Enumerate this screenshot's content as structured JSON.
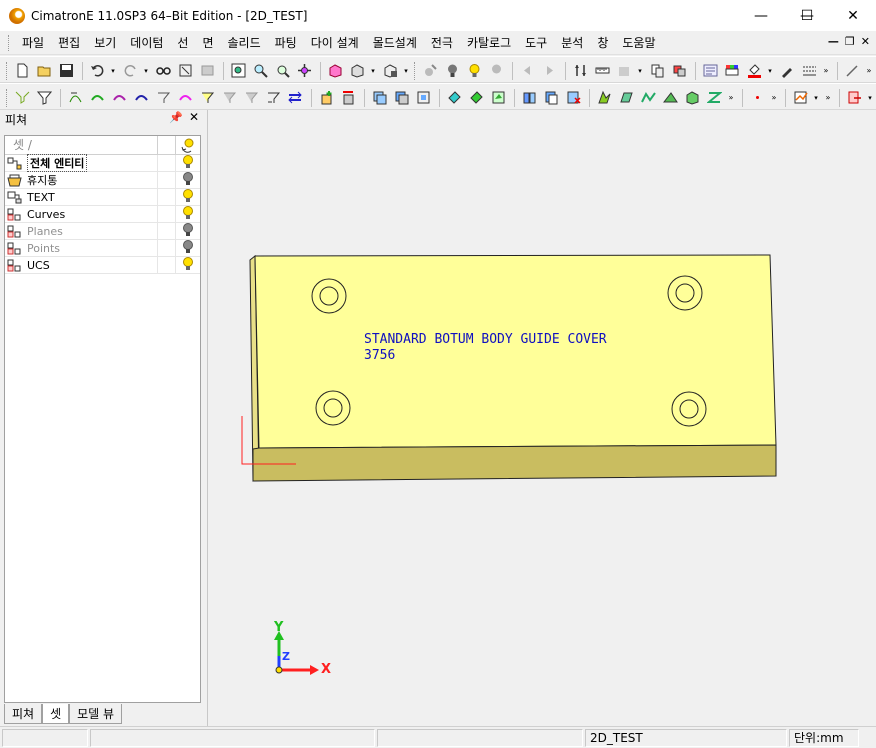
{
  "window": {
    "title": "CimatronE 11.0SP3 64–Bit Edition - [2D_TEST]",
    "minimize_glyph": "—",
    "maximize_glyph": "☐",
    "close_glyph": "✕"
  },
  "menu": {
    "items": [
      "파일",
      "편집",
      "보기",
      "데이텀",
      "선",
      "면",
      "솔리드",
      "파팅",
      "다이 설계",
      "몰드설계",
      "전극",
      "카탈로그",
      "도구",
      "분석",
      "창",
      "도움말"
    ],
    "mdi_controls": [
      "—",
      "❐",
      "✕"
    ]
  },
  "left_panel": {
    "title": "피쳐",
    "pin_glyph": "⬆",
    "close_glyph": "✕",
    "column_header": "셋 /",
    "rows": [
      {
        "label": "전체 엔티티",
        "icon": "all-entities-icon",
        "bulb": "on"
      },
      {
        "label": "휴지통",
        "icon": "trash-icon",
        "bulb": "off"
      },
      {
        "label": "TEXT",
        "icon": "text-set-icon",
        "bulb": "on"
      },
      {
        "label": "Curves",
        "icon": "set-icon",
        "bulb": "on"
      },
      {
        "label": "Planes",
        "icon": "set-icon",
        "bulb": "off"
      },
      {
        "label": "Points",
        "icon": "set-icon",
        "bulb": "off"
      },
      {
        "label": "UCS",
        "icon": "set-icon",
        "bulb": "on"
      }
    ],
    "tabs": [
      "피쳐",
      "셋",
      "모델 뷰"
    ],
    "active_tab": "셋"
  },
  "viewport": {
    "part_text_line1": "STANDARD BOTUM BODY GUIDE COVER",
    "part_text_line2": "3756",
    "axis_x": "X",
    "axis_y": "Y",
    "axis_z": "Z",
    "colors": {
      "part_top": "#ffff99",
      "part_front": "#c9bd60",
      "part_side": "#e8e088",
      "text": "#1010c0",
      "axis_x": "#ff2020",
      "axis_y": "#20c020",
      "axis_z": "#2040ff"
    }
  },
  "status": {
    "filename": "2D_TEST",
    "units": "단위:mm"
  }
}
